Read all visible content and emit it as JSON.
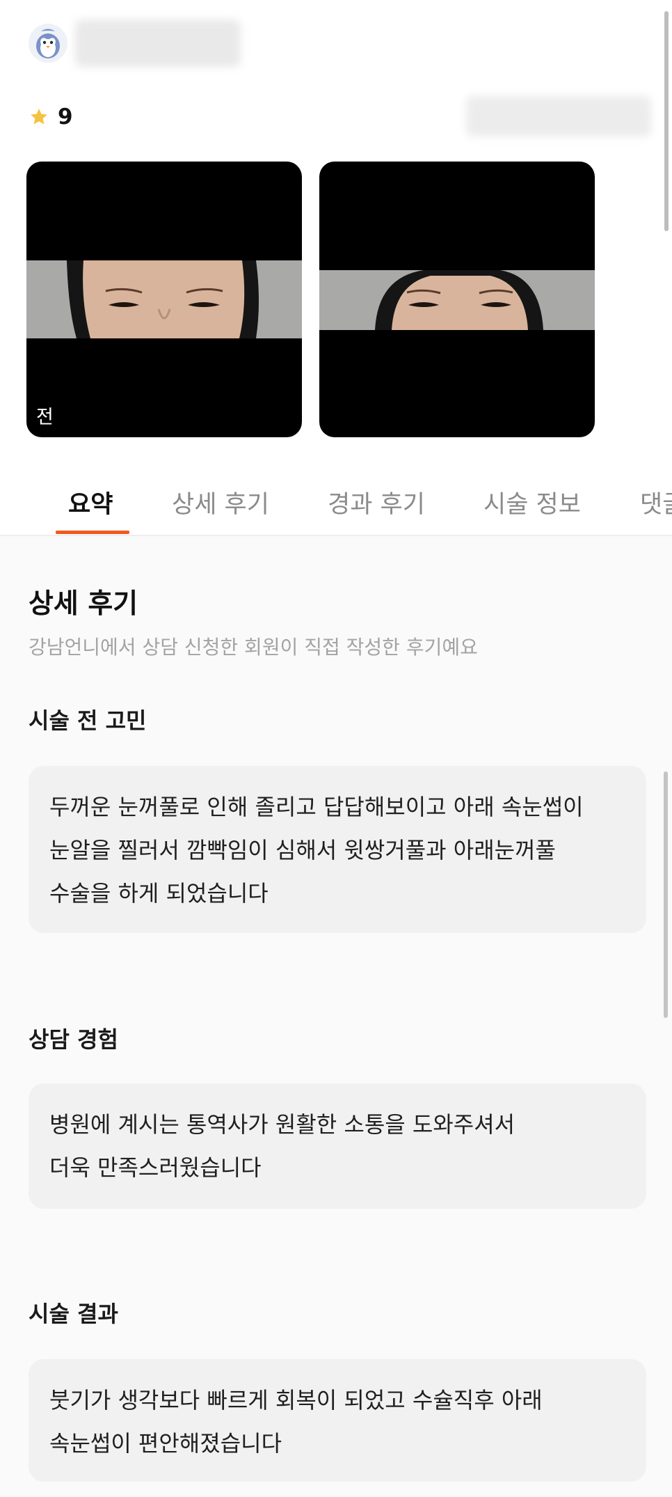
{
  "review": {
    "rating": "9"
  },
  "photos": {
    "before_label": "전"
  },
  "tabs": [
    {
      "label": "요약",
      "active": true
    },
    {
      "label": "상세 후기",
      "active": false
    },
    {
      "label": "경과 후기",
      "active": false
    },
    {
      "label": "시술 정보",
      "active": false
    },
    {
      "label": "댓글",
      "active": false
    }
  ],
  "detail": {
    "title": "상세 후기",
    "subtitle": "강남언니에서 상담 신청한 회원이 직접 작성한 후기예요",
    "sections": [
      {
        "label": "시술 전 고민",
        "lines": [
          "두꺼운 눈꺼풀로 인해 졸리고 답답해보이고 아래 속눈썹이",
          "눈알을 찔러서 깜빡임이 심해서 윗쌍거풀과 아래눈꺼풀",
          "수술을 하게 되었습니다"
        ]
      },
      {
        "label": "상담 경험",
        "lines": [
          "병원에 계시는 통역사가 원활한 소통을 도와주셔서",
          "더욱 만족스러웠습니다"
        ]
      },
      {
        "label": "시술 결과",
        "lines": [
          "붓기가 생각보다 빠르게 회복이 되었고 수슐직후 아래",
          "속눈썹이 편안해졌습니다"
        ]
      }
    ]
  },
  "colors": {
    "accent": "#ef5a1f",
    "star": "#f5c242",
    "card_bg": "#f1f1f1"
  },
  "icons": {
    "star": "star-icon",
    "avatar": "penguin-avatar-icon"
  }
}
